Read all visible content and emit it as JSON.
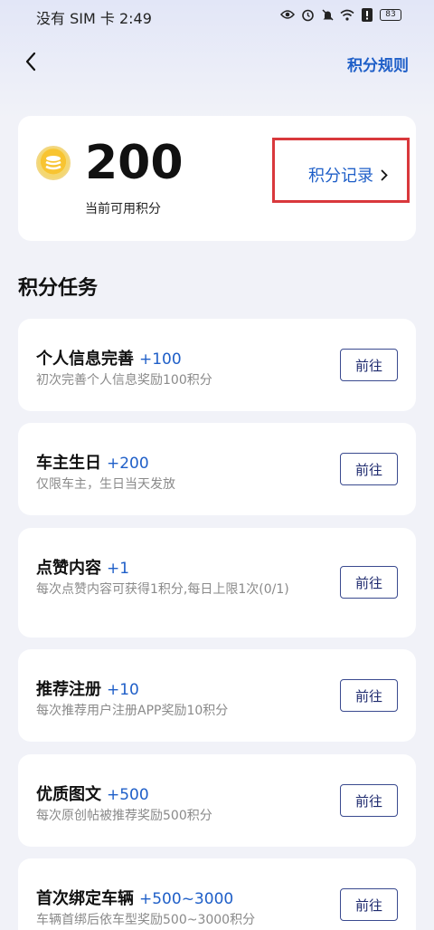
{
  "status_bar": {
    "carrier_time": "没有 SIM 卡 2:49",
    "battery": "83"
  },
  "header": {
    "rules_label": "积分规则"
  },
  "points": {
    "value": "200",
    "caption": "当前可用积分",
    "record_label": "积分记录"
  },
  "section_title": "积分任务",
  "tasks": [
    {
      "title": "个人信息完善",
      "reward": "+100",
      "desc": "初次完善个人信息奖励100积分",
      "button": "前往"
    },
    {
      "title": "车主生日",
      "reward": "+200",
      "desc": "仅限车主，生日当天发放",
      "button": "前往"
    },
    {
      "title": "点赞内容",
      "reward": "+1",
      "desc": "每次点赞内容可获得1积分,每日上限1次(0/1)",
      "button": "前往"
    },
    {
      "title": "推荐注册",
      "reward": "+10",
      "desc": "每次推荐用户注册APP奖励10积分",
      "button": "前往"
    },
    {
      "title": "优质图文",
      "reward": "+500",
      "desc": "每次原创帖被推荐奖励500积分",
      "button": "前往"
    },
    {
      "title": "首次绑定车辆",
      "reward": "+500~3000",
      "desc": "车辆首绑后依车型奖励500~3000积分",
      "button": "前往"
    }
  ]
}
